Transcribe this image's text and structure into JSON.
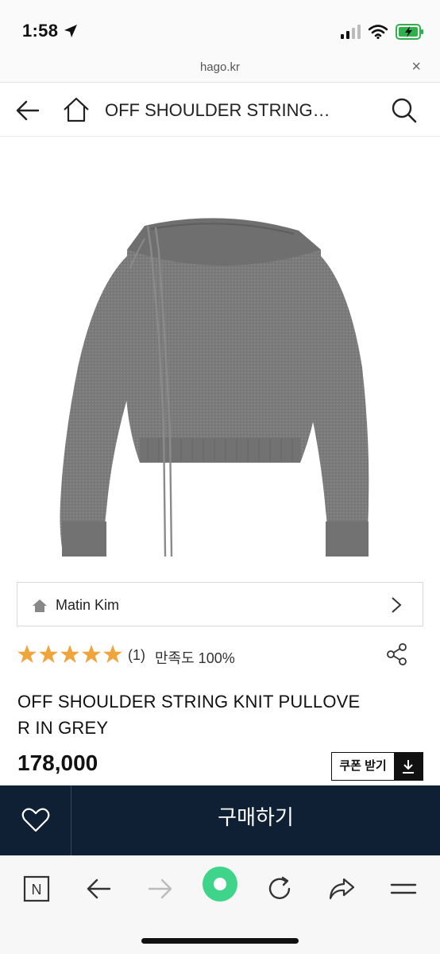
{
  "status_bar": {
    "time": "1:58"
  },
  "url_bar": {
    "domain": "hago.kr",
    "close": "×"
  },
  "header": {
    "title": "OFF SHOULDER STRING…"
  },
  "brand": {
    "name": "Matin Kim"
  },
  "rating": {
    "stars": 5,
    "star_color": "#f0a43c",
    "count": "(1)",
    "satisfaction": "만족도 100%"
  },
  "product": {
    "name": "OFF SHOULDER STRING KNIT PULLOVER IN GREY",
    "price": "178,000"
  },
  "coupon": {
    "label": "쿠폰 받기"
  },
  "buy_bar": {
    "buy_label": "구매하기",
    "background": "#0f2035"
  },
  "toolbar": {
    "n_label": "N",
    "accent": "#3ed58a"
  }
}
